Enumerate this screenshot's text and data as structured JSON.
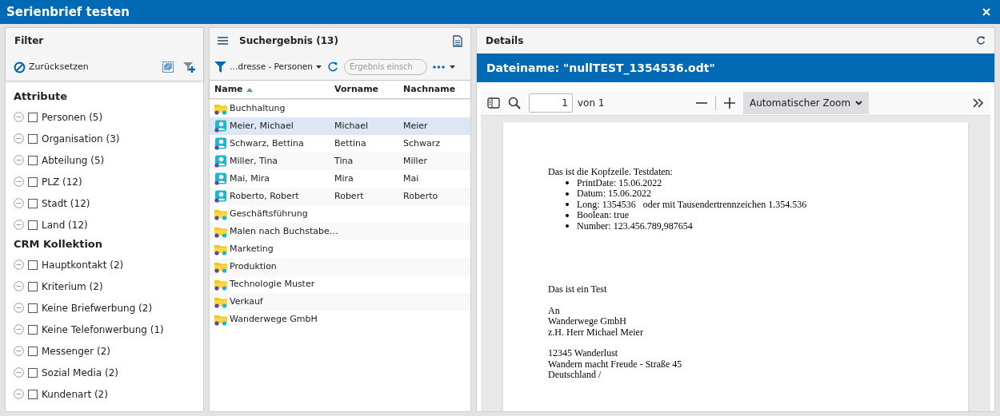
{
  "window": {
    "title": "Serienbrief testen"
  },
  "filter": {
    "title": "Filter",
    "reset_label": "Zurücksetzen",
    "sections": [
      {
        "title": "Attribute",
        "items": [
          {
            "label": "Personen (5)",
            "checked": false
          },
          {
            "label": "Organisation (3)",
            "checked": false
          },
          {
            "label": "Abteilung (5)",
            "checked": false
          },
          {
            "label": "PLZ (12)",
            "checked": false
          },
          {
            "label": "Stadt (12)",
            "checked": false
          },
          {
            "label": "Land (12)",
            "checked": false
          }
        ]
      },
      {
        "title": "CRM Kollektion",
        "items": [
          {
            "label": "Hauptkontakt (2)",
            "checked": false
          },
          {
            "label": "Kriterium (2)",
            "checked": false
          },
          {
            "label": "Keine Briefwerbung (2)",
            "checked": false
          },
          {
            "label": "Keine Telefonwerbung (1)",
            "checked": false
          },
          {
            "label": "Messenger (2)",
            "checked": false
          },
          {
            "label": "Sozial Media (2)",
            "checked": false
          },
          {
            "label": "Kundenart (2)",
            "checked": false
          }
        ]
      }
    ]
  },
  "results": {
    "title": "Suchergebnis (13)",
    "filter_label": "…dresse - Personen",
    "search_placeholder": "Ergebnis einsch",
    "columns": [
      {
        "label": "Name",
        "sorted": true
      },
      {
        "label": "Vorname",
        "sorted": false
      },
      {
        "label": "Nachname",
        "sorted": false
      }
    ],
    "rows": [
      {
        "kind": "folder",
        "name": "Buchhaltung",
        "selected": false
      },
      {
        "kind": "person",
        "name": "Meier, Michael",
        "first_name": "Michael",
        "last_name": "Meier",
        "selected": true
      },
      {
        "kind": "person",
        "name": "Schwarz, Bettina",
        "first_name": "Bettina",
        "last_name": "Schwarz",
        "selected": false
      },
      {
        "kind": "person",
        "name": "Miller, Tina",
        "first_name": "Tina",
        "last_name": "Miller",
        "selected": false
      },
      {
        "kind": "person",
        "name": "Mai, Mira",
        "first_name": "Mira",
        "last_name": "Mai",
        "selected": false
      },
      {
        "kind": "person",
        "name": "Roberto, Robert",
        "first_name": "Robert",
        "last_name": "Roberto",
        "selected": false
      },
      {
        "kind": "folder",
        "name": "Geschäftsführung",
        "selected": false
      },
      {
        "kind": "folder",
        "name": "Malen nach Buchstabe…",
        "selected": false
      },
      {
        "kind": "folder",
        "name": "Marketing",
        "selected": false
      },
      {
        "kind": "folder",
        "name": "Produktion",
        "selected": false
      },
      {
        "kind": "folder",
        "name": "Technologie Muster",
        "selected": false
      },
      {
        "kind": "folder",
        "name": "Verkauf",
        "selected": false
      },
      {
        "kind": "folder",
        "name": "Wanderwege GmbH",
        "selected": false
      }
    ]
  },
  "details": {
    "title": "Details",
    "file_name": "Dateiname: \"nullTEST_1354536.odt\"",
    "viewer": {
      "page": "1",
      "page_count": "von 1",
      "zoom": "Automatischer Zoom"
    },
    "document": {
      "header": "Das ist die Kopfzeile. Testdaten:",
      "bullets": [
        "PrintDate: 15.06.2022",
        "Datum: 15.06.2022",
        "Long: 1354536   oder mit Tausendertrennzeichen 1.354.536",
        "Boolean: true",
        "Number: 123.456.789,987654"
      ],
      "blocks": [
        [
          "Das ist ein Test"
        ],
        [
          "An",
          "Wanderwege GmbH",
          "z.H. Herr Michael Meier"
        ],
        [
          "12345 Wanderlust",
          "Wandern macht Freude - Straße 45",
          "Deutschland /"
        ]
      ]
    }
  }
}
